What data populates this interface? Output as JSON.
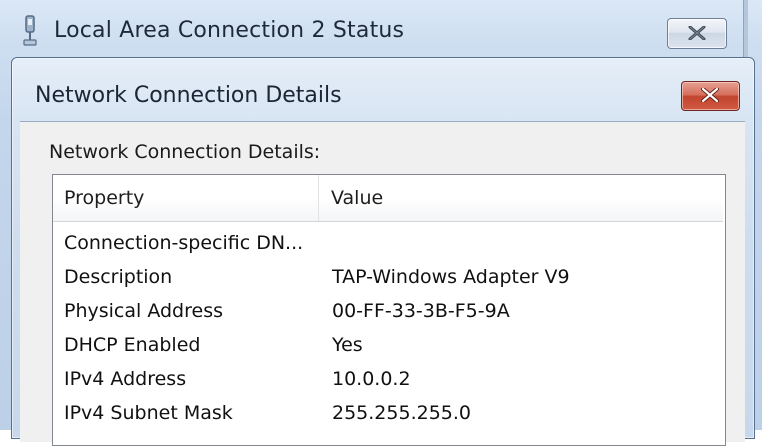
{
  "background_window": {
    "title": "Local Area Connection 2 Status",
    "icon": "network-plug-icon",
    "close_icon": "close-icon"
  },
  "dialog": {
    "title": "Network Connection Details",
    "close_icon": "close-icon",
    "details_label": "Network Connection Details:",
    "columns": {
      "property": "Property",
      "value": "Value"
    },
    "rows": [
      {
        "property": "Connection-specific DN...",
        "value": ""
      },
      {
        "property": "Description",
        "value": "TAP-Windows Adapter V9"
      },
      {
        "property": "Physical Address",
        "value": "00-FF-33-3B-F5-9A"
      },
      {
        "property": "DHCP Enabled",
        "value": "Yes"
      },
      {
        "property": "IPv4 Address",
        "value": "10.0.0.2"
      },
      {
        "property": "IPv4 Subnet Mask",
        "value": "255.255.255.0"
      }
    ]
  },
  "colors": {
    "close_red": "#c2452f",
    "title_text": "#1b2533",
    "frame_blue": "#cddcee"
  }
}
